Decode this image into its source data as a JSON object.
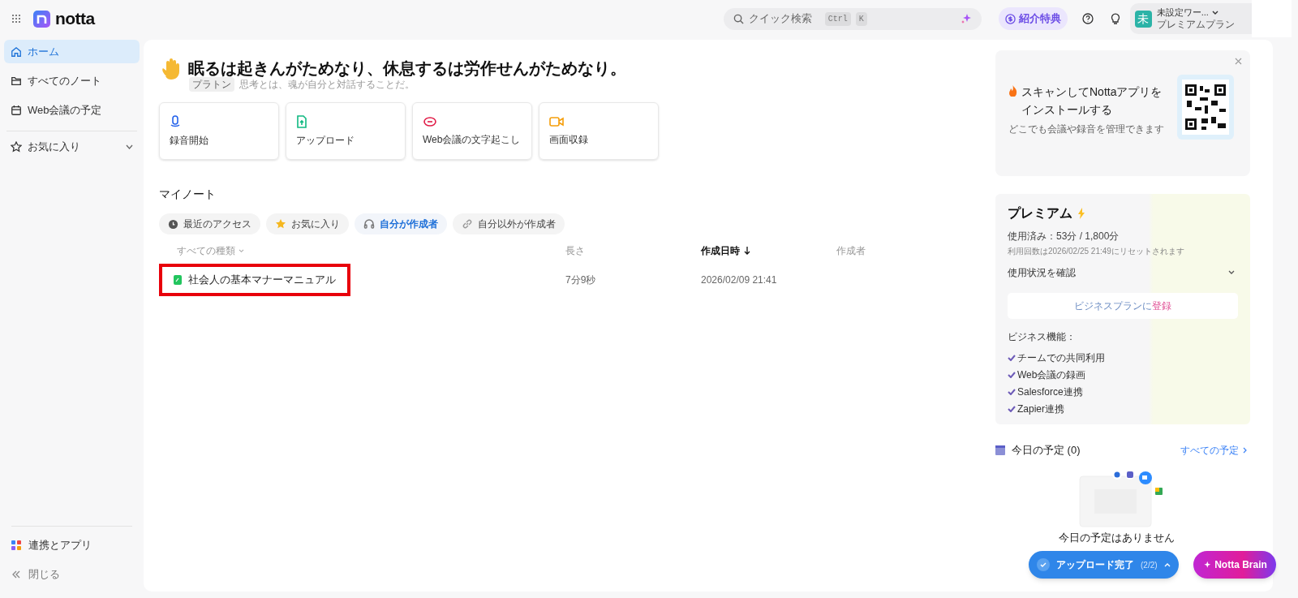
{
  "topbar": {
    "logo": "notta",
    "search": {
      "placeholder": "クイック検索",
      "keys": [
        "Ctrl",
        "K"
      ]
    },
    "referral": "紹介特典",
    "account": {
      "avatar": "未",
      "name": "未設定ワー...",
      "plan": "プレミアムプラン"
    }
  },
  "sidebar": {
    "items": [
      {
        "label": "ホーム",
        "selected": true
      },
      {
        "label": "すべてのノート",
        "selected": false
      },
      {
        "label": "Web会議の予定",
        "selected": false
      }
    ],
    "favorites": {
      "label": "お気に入り",
      "expanded": false
    },
    "bottom": [
      {
        "label": "連携とアプリ",
        "kind": "apps"
      },
      {
        "label": "閉じる",
        "kind": "collapse"
      }
    ]
  },
  "greeting": {
    "title": "眠るは起きんがためなり、休息するは労作せんがためなり。",
    "author": "プラトン",
    "quote": "思考とは、魂が自分と対話することだ。"
  },
  "actions": [
    {
      "label": "録音開始"
    },
    {
      "label": "アップロード"
    },
    {
      "label": "Web会議の文字起こし"
    },
    {
      "label": "画面収録"
    }
  ],
  "notes": {
    "title": "マイノート",
    "filters": [
      {
        "label": "最近のアクセス",
        "selected": false
      },
      {
        "label": "お気に入り",
        "selected": false
      },
      {
        "label": "自分が作成者",
        "selected": true
      },
      {
        "label": "自分以外が作成者",
        "selected": false
      }
    ],
    "columns": [
      {
        "label": "すべての種類",
        "kind": "dropdown"
      },
      {
        "label": "長さ",
        "kind": "plain"
      },
      {
        "label": "作成日時",
        "kind": "sorted"
      },
      {
        "label": "作成者",
        "kind": "plain"
      }
    ],
    "rows": [
      {
        "name": "社会人の基本マナーマニュアル",
        "length": "7分9秒",
        "created": "2026/02/09 21:41",
        "highlighted": true
      }
    ]
  },
  "app_promo": {
    "title": "スキャンしてNottaアプリをインストールする",
    "subtitle": "どこでも会議や録音を管理できます"
  },
  "premium": {
    "title": "プレミアム",
    "usage": "使用済み：53分 / 1,800分",
    "reset": "利用回数は2026/02/25 21:49にリセットされます",
    "usage_toggle": "使用状況を確認",
    "upgrade": [
      "ビジネスプランに",
      "登録"
    ],
    "features_title": "ビジネス機能：",
    "features": [
      "チームでの共同利用",
      "Web会議の録画",
      "Salesforce連携",
      "Zapier連携"
    ]
  },
  "today": {
    "title": "今日の予定 (0)",
    "all_link": "すべての予定",
    "empty": "今日の予定はありません"
  },
  "floating": {
    "upload": {
      "label": "アップロード完了",
      "count": "(2/2)"
    },
    "brain": "Notta Brain"
  }
}
